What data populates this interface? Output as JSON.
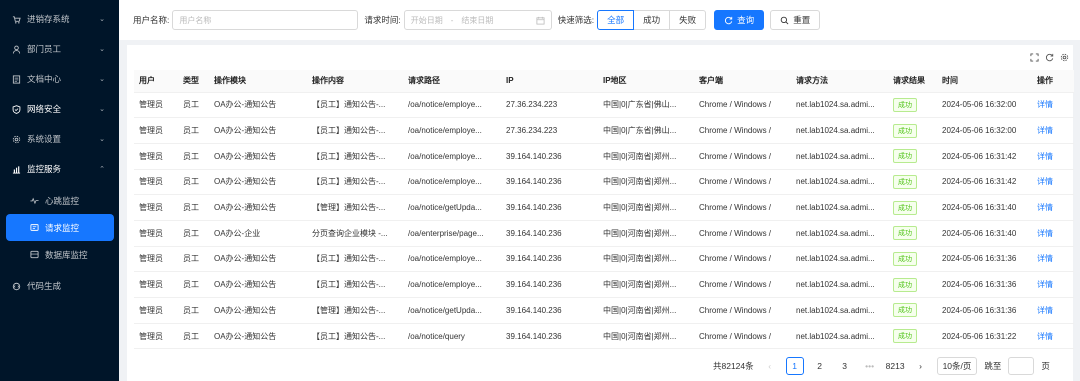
{
  "sidebar": {
    "items": [
      {
        "label": "进销存系统",
        "icon": "cart-icon",
        "chevron": "⌄"
      },
      {
        "label": "部门员工",
        "icon": "user-icon",
        "chevron": "⌄"
      },
      {
        "label": "文档中心",
        "icon": "document-icon",
        "chevron": "⌄"
      },
      {
        "label": "网络安全",
        "icon": "shield-icon",
        "chevron": "⌄"
      },
      {
        "label": "系统设置",
        "icon": "gear-icon",
        "chevron": "⌄"
      },
      {
        "label": "监控服务",
        "icon": "chart-icon",
        "chevron": "⌃"
      }
    ],
    "sub_items": [
      {
        "label": "心跳监控",
        "icon": "heartbeat-icon"
      },
      {
        "label": "请求监控",
        "icon": "request-icon"
      },
      {
        "label": "数据库监控",
        "icon": "database-icon"
      }
    ],
    "last_item": {
      "label": "代码生成",
      "icon": "code-icon"
    }
  },
  "filters": {
    "user_label": "用户名称:",
    "user_placeholder": "用户名称",
    "time_label": "请求时间:",
    "start_placeholder": "开始日期",
    "end_placeholder": "结束日期",
    "sep": "-",
    "quick_label": "快速筛选:",
    "quick_options": [
      "全部",
      "成功",
      "失败"
    ],
    "search_label": "查询",
    "reset_label": "重置"
  },
  "table": {
    "headers": [
      "用户",
      "类型",
      "操作模块",
      "操作内容",
      "请求路径",
      "IP",
      "IP地区",
      "客户端",
      "请求方法",
      "请求结果",
      "时间",
      "操作"
    ],
    "rows": [
      [
        "管理员",
        "员工",
        "OA办公-通知公告",
        "【员工】通知公告-...",
        "/oa/notice/employe...",
        "27.36.234.223",
        "中国|0|广东省|佛山...",
        "Chrome / Windows /",
        "net.lab1024.sa.admi...",
        "成功",
        "2024-05-06 16:32:00",
        "详情"
      ],
      [
        "管理员",
        "员工",
        "OA办公-通知公告",
        "【员工】通知公告-...",
        "/oa/notice/employe...",
        "27.36.234.223",
        "中国|0|广东省|佛山...",
        "Chrome / Windows /",
        "net.lab1024.sa.admi...",
        "成功",
        "2024-05-06 16:32:00",
        "详情"
      ],
      [
        "管理员",
        "员工",
        "OA办公-通知公告",
        "【员工】通知公告-...",
        "/oa/notice/employe...",
        "39.164.140.236",
        "中国|0|河南省|郑州...",
        "Chrome / Windows /",
        "net.lab1024.sa.admi...",
        "成功",
        "2024-05-06 16:31:42",
        "详情"
      ],
      [
        "管理员",
        "员工",
        "OA办公-通知公告",
        "【员工】通知公告-...",
        "/oa/notice/employe...",
        "39.164.140.236",
        "中国|0|河南省|郑州...",
        "Chrome / Windows /",
        "net.lab1024.sa.admi...",
        "成功",
        "2024-05-06 16:31:42",
        "详情"
      ],
      [
        "管理员",
        "员工",
        "OA办公-通知公告",
        "【管理】通知公告-...",
        "/oa/notice/getUpda...",
        "39.164.140.236",
        "中国|0|河南省|郑州...",
        "Chrome / Windows /",
        "net.lab1024.sa.admi...",
        "成功",
        "2024-05-06 16:31:40",
        "详情"
      ],
      [
        "管理员",
        "员工",
        "OA办公-企业",
        "分页查询企业模块 -...",
        "/oa/enterprise/page...",
        "39.164.140.236",
        "中国|0|河南省|郑州...",
        "Chrome / Windows /",
        "net.lab1024.sa.admi...",
        "成功",
        "2024-05-06 16:31:40",
        "详情"
      ],
      [
        "管理员",
        "员工",
        "OA办公-通知公告",
        "【员工】通知公告-...",
        "/oa/notice/employe...",
        "39.164.140.236",
        "中国|0|河南省|郑州...",
        "Chrome / Windows /",
        "net.lab1024.sa.admi...",
        "成功",
        "2024-05-06 16:31:36",
        "详情"
      ],
      [
        "管理员",
        "员工",
        "OA办公-通知公告",
        "【员工】通知公告-...",
        "/oa/notice/employe...",
        "39.164.140.236",
        "中国|0|河南省|郑州...",
        "Chrome / Windows /",
        "net.lab1024.sa.admi...",
        "成功",
        "2024-05-06 16:31:36",
        "详情"
      ],
      [
        "管理员",
        "员工",
        "OA办公-通知公告",
        "【管理】通知公告-...",
        "/oa/notice/getUpda...",
        "39.164.140.236",
        "中国|0|河南省|郑州...",
        "Chrome / Windows /",
        "net.lab1024.sa.admi...",
        "成功",
        "2024-05-06 16:31:36",
        "详情"
      ],
      [
        "管理员",
        "员工",
        "OA办公-通知公告",
        "【员工】通知公告-...",
        "/oa/notice/query",
        "39.164.140.236",
        "中国|0|河南省|郑州...",
        "Chrome / Windows /",
        "net.lab1024.sa.admi...",
        "成功",
        "2024-05-06 16:31:22",
        "详情"
      ]
    ]
  },
  "pagination": {
    "total": "共82124条",
    "prev": "‹",
    "pages": [
      "1",
      "2",
      "3"
    ],
    "ellipsis": "•••",
    "last_page": "8213",
    "next": "›",
    "page_size": "10条/页",
    "goto_label": "跳至",
    "goto_suffix": "页"
  },
  "colors": {
    "primary": "#1677ff",
    "sidebar_bg": "#001529",
    "success": "#52c41a"
  }
}
